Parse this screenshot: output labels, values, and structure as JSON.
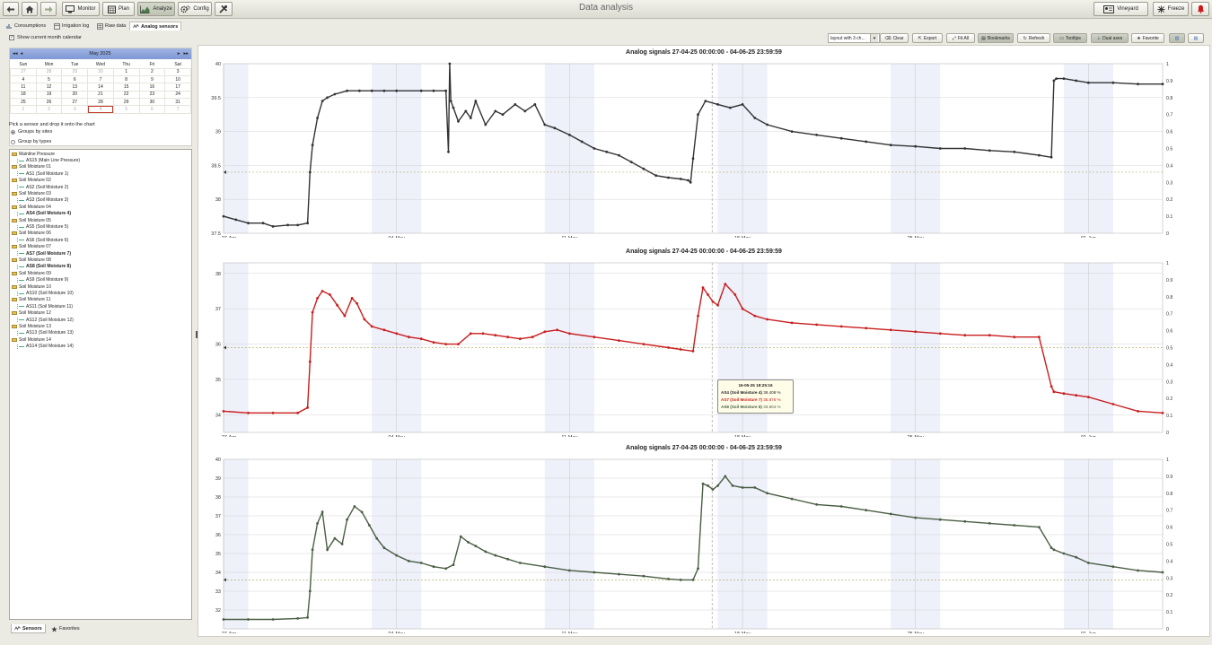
{
  "toolbar": {
    "monitor_label": "Monitor",
    "plan_label": "Plan",
    "analyze_label": "Analyze",
    "config_label": "Config",
    "title": "Data analysis",
    "account_label": "Vineyard",
    "freeze_label": "Freeze"
  },
  "tabs": [
    {
      "label": "Consumptions"
    },
    {
      "label": "Irrigation log"
    },
    {
      "label": "Raw data"
    },
    {
      "label": "Analog sensors"
    }
  ],
  "sidebar": {
    "show_calendar_label": "Show current month calendar",
    "calendar": {
      "month_label": "May 2025",
      "weekdays": [
        "Sun",
        "Mon",
        "Tue",
        "Wed",
        "Thu",
        "Fri",
        "Sat"
      ],
      "weeks": [
        [
          "27",
          "28",
          "29",
          "30",
          "1",
          "2",
          "3"
        ],
        [
          "4",
          "5",
          "6",
          "7",
          "8",
          "9",
          "10"
        ],
        [
          "11",
          "12",
          "13",
          "14",
          "15",
          "16",
          "17"
        ],
        [
          "18",
          "19",
          "20",
          "21",
          "22",
          "23",
          "24"
        ],
        [
          "25",
          "26",
          "27",
          "28",
          "29",
          "30",
          "31"
        ],
        [
          "1",
          "2",
          "3",
          "4",
          "5",
          "6",
          "7"
        ]
      ]
    },
    "pick_hint": "Pick a sensor and drop it onto the chart",
    "group_sites_label": "Groups by sites",
    "group_types_label": "Group by types",
    "tree": [
      {
        "type": "group",
        "label": "Mainline Pressure"
      },
      {
        "type": "sensor",
        "label": "AS15 (Main Line Pressure)"
      },
      {
        "type": "group",
        "label": "Soil Moisture 01"
      },
      {
        "type": "sensor",
        "label": "AS1 (Soil Moisture 1)"
      },
      {
        "type": "group",
        "label": "Soil Moisture 02"
      },
      {
        "type": "sensor",
        "label": "AS2 (Soil Moisture 2)"
      },
      {
        "type": "group",
        "label": "Soil Moisture 03"
      },
      {
        "type": "sensor",
        "label": "AS3 (Soil Moisture 3)"
      },
      {
        "type": "group",
        "label": "Soil Moisture 04"
      },
      {
        "type": "sensor",
        "label": "AS4 (Soil Moisture 4)",
        "bold": true
      },
      {
        "type": "group",
        "label": "Soil Moisture 05"
      },
      {
        "type": "sensor",
        "label": "AS5 (Soil Moisture 5)"
      },
      {
        "type": "group",
        "label": "Soil Moisture 06"
      },
      {
        "type": "sensor",
        "label": "AS6 (Soil Moisture 6)"
      },
      {
        "type": "group",
        "label": "Soil Moisture 07"
      },
      {
        "type": "sensor",
        "label": "AS7 (Soil Moisture 7)",
        "bold": true
      },
      {
        "type": "group",
        "label": "Soil Moisture 08"
      },
      {
        "type": "sensor",
        "label": "AS8 (Soil Moisture 8)",
        "bold": true
      },
      {
        "type": "group",
        "label": "Soil Moisture 09"
      },
      {
        "type": "sensor",
        "label": "AS9 (Soil Moisture 9)"
      },
      {
        "type": "group",
        "label": "Soil Moisture 10"
      },
      {
        "type": "sensor",
        "label": "AS10 (Soil Moisture 10)"
      },
      {
        "type": "group",
        "label": "Soil Moisture 11"
      },
      {
        "type": "sensor",
        "label": "AS11 (Soil Moisture 11)"
      },
      {
        "type": "group",
        "label": "Soil Moisture 12"
      },
      {
        "type": "sensor",
        "label": "AS12 (Soil Moisture 12)"
      },
      {
        "type": "group",
        "label": "Soil Moisture 13"
      },
      {
        "type": "sensor",
        "label": "AS13 (Soil Moisture 13)"
      },
      {
        "type": "group",
        "label": "Soil Moisture 14"
      },
      {
        "type": "sensor",
        "label": "AS14 (Soil Moisture 14)"
      }
    ],
    "bottom_tabs": [
      {
        "label": "Sensors"
      },
      {
        "label": "Favorites"
      }
    ]
  },
  "chart_toolbar": {
    "layout_value": "layout with 3 ch...",
    "clear": "Clear",
    "export": "Export",
    "fit_all": "Fit All",
    "bookmarks": "Bookmarks",
    "refresh": "Refresh",
    "tooltips": "Tooltips",
    "dual_axes": "Dual axes",
    "favorite": "Favorite"
  },
  "tooltip": {
    "time": "16-05-25 18:25:16",
    "rows": [
      {
        "label": "AS4 (Soil Moisture 4)",
        "value": "38.408 %",
        "color": "#333333"
      },
      {
        "label": "AS7 (Soil Moisture 7)",
        "value": "35.876 %",
        "color": "#c81e1e"
      },
      {
        "label": "AS8 (Soil Moisture 8)",
        "value": "33.604 %",
        "color": "#4a5e44"
      }
    ]
  },
  "chart_data": [
    {
      "type": "line",
      "title": "Analog signals 27-04-25 00:00:00 - 04-06-25 23:59:59",
      "color": "#333333",
      "x_ticks": [
        "27-Apr",
        "04-May",
        "11-May",
        "18-May",
        "25-May",
        "01-Jun"
      ],
      "yticks": [
        "37.5",
        "38",
        "38.5",
        "39",
        "39.5",
        "40"
      ],
      "ylim": [
        37.5,
        40
      ],
      "y2ticks": [
        "0",
        "0.1",
        "0.2",
        "0.3",
        "0.4",
        "0.5",
        "0.6",
        "0.7",
        "0.8",
        "0.9",
        "1"
      ],
      "y2lim": [
        0,
        1
      ],
      "threshold": 38.4,
      "grid": true,
      "series": [
        {
          "x": [
            0,
            0.5,
            1,
            1.6,
            2,
            2.6,
            3,
            3.4,
            3.5,
            3.6,
            3.8,
            4,
            4.2,
            4.5,
            5,
            5.5,
            6,
            6.5,
            7,
            8,
            8.5,
            9,
            9.1,
            9.15,
            9.2,
            9.3,
            9.5,
            9.8,
            10,
            10.2,
            10.6,
            11,
            11.3,
            11.8,
            12.2,
            12.6,
            13,
            13.4,
            14,
            14.5,
            15,
            15.5,
            16,
            16.5,
            17,
            17.5,
            18,
            18.5,
            18.8,
            18.9,
            19,
            19.2,
            19.5,
            20,
            20.5,
            21,
            21.5,
            22,
            23,
            24,
            25,
            26,
            27,
            28,
            29,
            30,
            31,
            32,
            33,
            33.5,
            33.6,
            33.7,
            34,
            34.5,
            35,
            36,
            37,
            38
          ],
          "y": [
            37.75,
            37.7,
            37.65,
            37.65,
            37.6,
            37.62,
            37.62,
            37.65,
            38.4,
            38.8,
            39.2,
            39.45,
            39.5,
            39.55,
            39.6,
            39.6,
            39.6,
            39.6,
            39.6,
            39.6,
            39.6,
            39.6,
            38.7,
            40,
            39.45,
            39.35,
            39.15,
            39.3,
            39.2,
            39.45,
            39.1,
            39.3,
            39.25,
            39.4,
            39.3,
            39.4,
            39.1,
            39.05,
            38.95,
            38.85,
            38.75,
            38.7,
            38.65,
            38.55,
            38.45,
            38.35,
            38.32,
            38.3,
            38.28,
            38.25,
            38.6,
            39.25,
            39.45,
            39.4,
            39.35,
            39.4,
            39.2,
            39.1,
            39.0,
            38.95,
            38.9,
            38.85,
            38.8,
            38.78,
            38.75,
            38.75,
            38.72,
            38.7,
            38.65,
            38.62,
            39.75,
            39.78,
            39.78,
            39.75,
            39.72,
            39.72,
            39.7,
            39.7
          ]
        }
      ]
    },
    {
      "type": "line",
      "title": "Analog signals 27-04-25 00:00:00 - 04-06-25 23:59:59",
      "color": "#c81e1e",
      "x_ticks": [
        "27-Apr",
        "04-May",
        "11-May",
        "18-May",
        "25-May",
        "01-Jun"
      ],
      "yticks": [
        "34",
        "35",
        "36",
        "37",
        "38"
      ],
      "ylim": [
        33.5,
        38.3
      ],
      "y2ticks": [
        "0",
        "0.1",
        "0.2",
        "0.3",
        "0.4",
        "0.5",
        "0.6",
        "0.7",
        "0.8",
        "0.9",
        "1"
      ],
      "y2lim": [
        0,
        1
      ],
      "threshold": 35.9,
      "grid": true,
      "series": [
        {
          "x": [
            0,
            1,
            2,
            3,
            3.4,
            3.5,
            3.6,
            3.8,
            4,
            4.3,
            4.6,
            4.9,
            5.2,
            5.4,
            5.7,
            6,
            6.5,
            7,
            7.5,
            8,
            8.5,
            9,
            9.5,
            10,
            10.5,
            11,
            11.5,
            12,
            12.5,
            13,
            13.5,
            14,
            15,
            16,
            17,
            18,
            18.5,
            19,
            19.2,
            19.4,
            19.6,
            19.8,
            20,
            20.3,
            20.7,
            21,
            21.5,
            22,
            23,
            24,
            25,
            26,
            27,
            28,
            29,
            30,
            31,
            32,
            33,
            33.5,
            33.6,
            34,
            34.5,
            35,
            36,
            37,
            38
          ],
          "y": [
            34.1,
            34.05,
            34.05,
            34.05,
            34.2,
            35.5,
            36.9,
            37.3,
            37.5,
            37.4,
            37.1,
            36.8,
            37.3,
            37.15,
            36.7,
            36.5,
            36.4,
            36.3,
            36.2,
            36.15,
            36.05,
            36.0,
            36.0,
            36.3,
            36.3,
            36.25,
            36.2,
            36.15,
            36.2,
            36.35,
            36.4,
            36.3,
            36.2,
            36.1,
            36.0,
            35.9,
            35.85,
            35.8,
            36.8,
            37.6,
            37.4,
            37.2,
            37.1,
            37.7,
            37.4,
            37.0,
            36.8,
            36.7,
            36.6,
            36.55,
            36.5,
            36.45,
            36.4,
            36.35,
            36.3,
            36.25,
            36.25,
            36.2,
            36.2,
            34.8,
            34.65,
            34.6,
            34.55,
            34.5,
            34.3,
            34.1,
            34.05
          ]
        }
      ]
    },
    {
      "type": "line",
      "title": "Analog signals 27-04-25 00:00:00 - 04-06-25 23:59:59",
      "color": "#4a5e44",
      "x_ticks": [
        "27-Apr",
        "04-May",
        "11-May",
        "18-May",
        "25-May",
        "01-Jun"
      ],
      "yticks": [
        "32",
        "33",
        "34",
        "35",
        "36",
        "37",
        "38",
        "39",
        "40"
      ],
      "ylim": [
        31,
        40
      ],
      "y2ticks": [
        "0",
        "0.1",
        "0.2",
        "0.3",
        "0.4",
        "0.5",
        "0.6",
        "0.7",
        "0.8",
        "0.9",
        "1"
      ],
      "y2lim": [
        0,
        1
      ],
      "threshold": 33.6,
      "grid": true,
      "series": [
        {
          "x": [
            0,
            1,
            2,
            3,
            3.4,
            3.5,
            3.6,
            3.8,
            4,
            4.2,
            4.5,
            4.8,
            5,
            5.3,
            5.6,
            5.9,
            6.2,
            6.5,
            7,
            7.5,
            8,
            8.5,
            9,
            9.3,
            9.6,
            9.9,
            10.2,
            10.6,
            11,
            11.5,
            12,
            13,
            14,
            15,
            16,
            17,
            18,
            18.5,
            19,
            19.2,
            19.4,
            19.6,
            19.8,
            20,
            20.3,
            20.6,
            21,
            21.5,
            22,
            23,
            24,
            25,
            26,
            27,
            28,
            29,
            30,
            31,
            32,
            33,
            33.5,
            33.6,
            34,
            34.5,
            35,
            36,
            37,
            38
          ],
          "y": [
            31.5,
            31.5,
            31.5,
            31.55,
            31.6,
            33.0,
            35.2,
            36.6,
            37.2,
            35.2,
            35.8,
            35.5,
            36.8,
            37.5,
            37.2,
            36.5,
            35.8,
            35.3,
            34.9,
            34.6,
            34.5,
            34.3,
            34.2,
            34.4,
            35.9,
            35.6,
            35.4,
            35.1,
            34.9,
            34.7,
            34.5,
            34.3,
            34.1,
            34.0,
            33.9,
            33.8,
            33.65,
            33.6,
            33.6,
            34.2,
            38.7,
            38.6,
            38.4,
            38.6,
            39.1,
            38.6,
            38.5,
            38.5,
            38.2,
            37.9,
            37.6,
            37.5,
            37.3,
            37.1,
            36.9,
            36.8,
            36.7,
            36.6,
            36.5,
            36.4,
            35.3,
            35.2,
            35.0,
            34.8,
            34.5,
            34.3,
            34.1,
            34.0
          ]
        }
      ]
    }
  ]
}
